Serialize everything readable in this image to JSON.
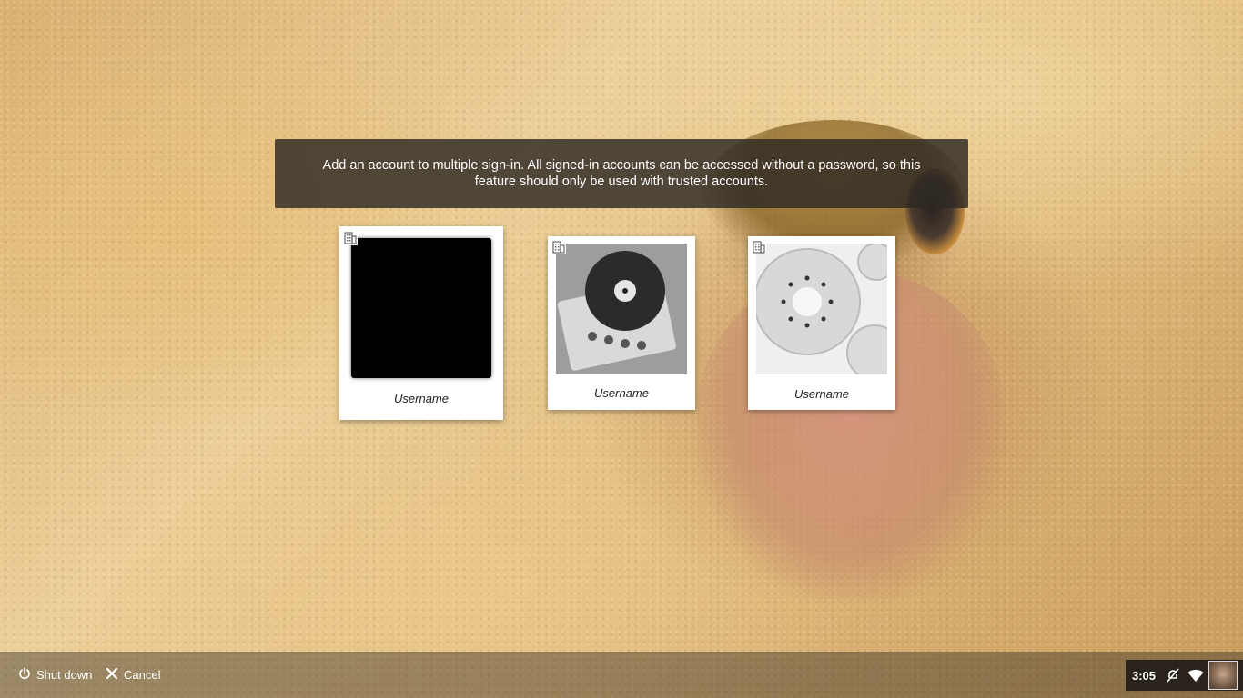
{
  "notice": {
    "line1": "Add an account to multiple sign-in. All signed-in accounts can be accessed without a password, so this",
    "line2": "feature should only be used with trusted accounts."
  },
  "accounts": [
    {
      "name": "Username",
      "badge_icon": "building-icon",
      "picture": "black-square"
    },
    {
      "name": "Username",
      "badge_icon": "building-icon",
      "picture": "record-player-photo"
    },
    {
      "name": "Username",
      "badge_icon": "building-icon",
      "picture": "kiwi-slices-photo"
    }
  ],
  "shelf": {
    "shutdown_label": "Shut down",
    "shutdown_icon": "power-icon",
    "cancel_label": "Cancel",
    "cancel_icon": "close-icon"
  },
  "tray": {
    "time": "3:05",
    "icons": [
      "notifications-off-icon",
      "wifi-icon",
      "user-avatar"
    ]
  }
}
